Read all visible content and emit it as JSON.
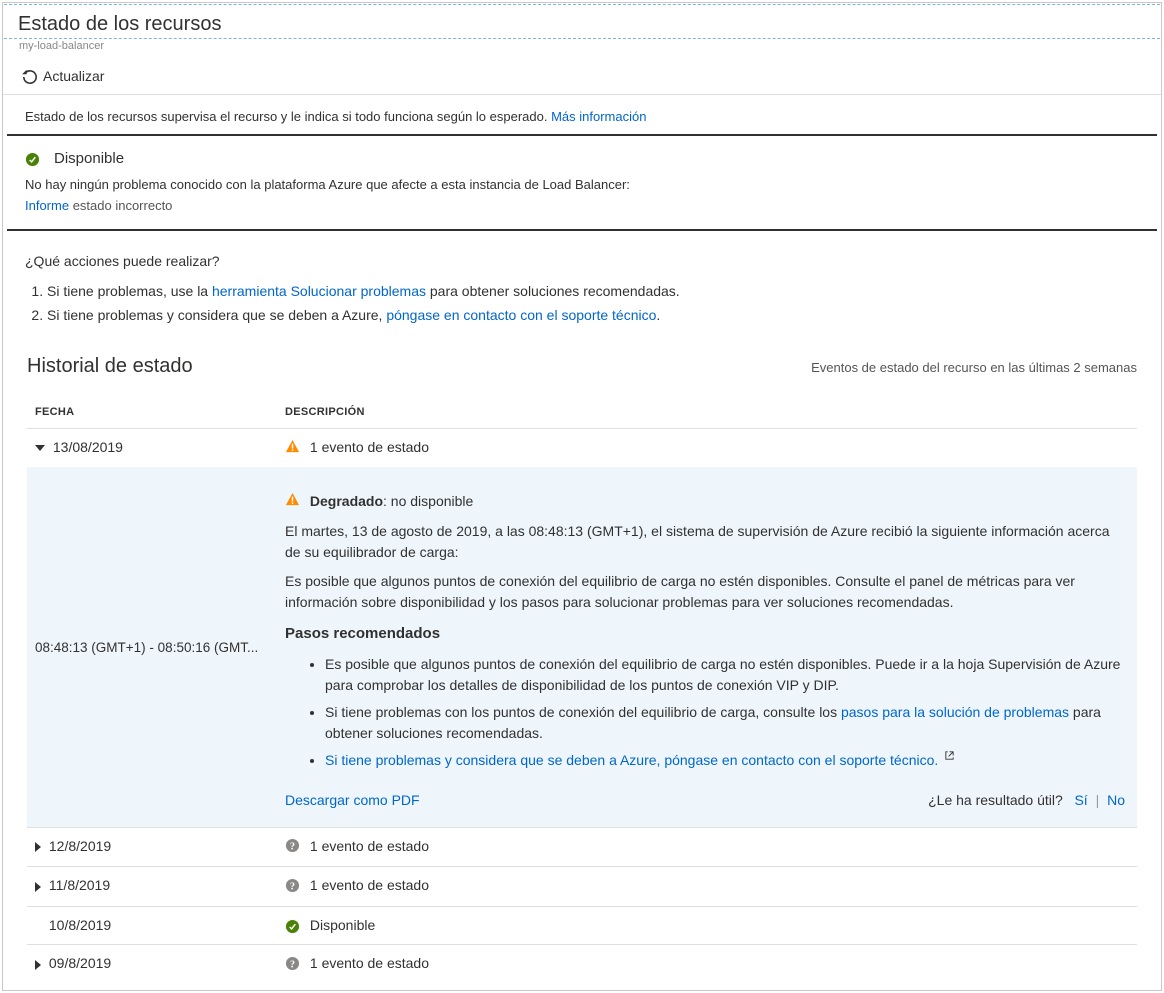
{
  "header": {
    "title": "Estado de los recursos",
    "subtitle": "my-load-balancer"
  },
  "toolbar": {
    "refresh_label": "Actualizar"
  },
  "intro": {
    "text": "Estado de los recursos supervisa el recurso y le indica si todo funciona según lo esperado.",
    "more_info": "Más información"
  },
  "status": {
    "label": "Disponible",
    "detail_plain": "No hay ningún problema conocido con la plataforma Azure que afecte a esta instancia de Load Balancer:",
    "report_link": "Informe",
    "report_rest": " estado incorrecto"
  },
  "actions": {
    "title": "¿Qué acciones puede realizar?",
    "item1_pre": "Si tiene problemas, use la ",
    "item1_link": "herramienta Solucionar problemas",
    "item1_post": " para obtener soluciones recomendadas.",
    "item2_pre": "Si tiene problemas y considera que se deben a Azure, ",
    "item2_link": "póngase en contacto con el soporte técnico",
    "item2_post": "."
  },
  "history": {
    "title": "Historial de estado",
    "subtitle": "Eventos de estado del recurso en las últimas 2 semanas",
    "col_date": "Fecha",
    "col_desc": "Descripción",
    "rows": [
      {
        "date": "13/08/2019",
        "desc": "1 evento de estado",
        "expanded": true,
        "icon": "warn"
      },
      {
        "date": "12/8/2019",
        "desc": "1 evento de estado",
        "expanded": false,
        "icon": "q"
      },
      {
        "date": "11/8/2019",
        "desc": "1 evento de estado",
        "expanded": false,
        "icon": "q"
      },
      {
        "date": "10/8/2019",
        "desc": "Disponible",
        "expanded": false,
        "icon": "ok",
        "nocaret": true
      },
      {
        "date": "09/8/2019",
        "desc": "1 evento de estado",
        "expanded": false,
        "icon": "q"
      }
    ]
  },
  "expanded": {
    "time_range": "08:48:13 (GMT+1) - 08:50:16 (GMT...",
    "status_bold": "Degradado",
    "status_rest": ": no disponible",
    "para1": "El martes, 13 de agosto de 2019, a las 08:48:13 (GMT+1), el sistema de supervisión de Azure recibió la siguiente información acerca de su equilibrador de carga:",
    "para2": "Es posible que algunos puntos de conexión del equilibrio de carga no estén disponibles. Consulte el panel de métricas para ver información sobre disponibilidad y los pasos para solucionar problemas para ver soluciones recomendadas.",
    "steps_title": "Pasos recomendados",
    "step1": "Es posible que algunos puntos de conexión del equilibrio de carga no estén disponibles. Puede ir a la hoja Supervisión de Azure para comprobar los detalles de disponibilidad de los puntos de conexión VIP y DIP.",
    "step2_pre": "Si tiene problemas con los puntos de conexión del equilibrio de carga, consulte los ",
    "step2_link": "pasos para la solución de problemas",
    "step2_post": " para obtener soluciones recomendadas.",
    "step3_link": "Si tiene problemas y considera que se deben a Azure, póngase en contacto con el soporte técnico.",
    "download_pdf": "Descargar como PDF",
    "useful_q": "¿Le ha resultado útil?",
    "yes": "Sí",
    "no": "No"
  }
}
